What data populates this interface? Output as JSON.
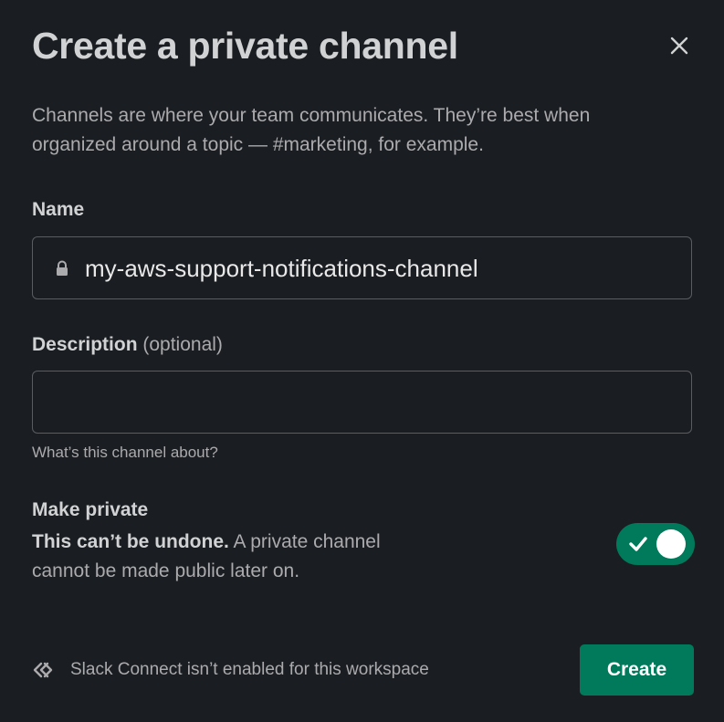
{
  "modal": {
    "title": "Create a private channel",
    "close_icon": "close-icon",
    "intro": "Channels are where your team communicates. They’re best when organized around a topic — #marketing, for example."
  },
  "name_field": {
    "label": "Name",
    "icon": "lock-icon",
    "value": "my-aws-support-notifications-channel"
  },
  "description_field": {
    "label": "Description",
    "optional": "(optional)",
    "value": "",
    "hint": "What’s this channel about?"
  },
  "private_setting": {
    "title": "Make private",
    "warning": "This can’t be undone.",
    "detail": "A private channel cannot be made public later on.",
    "enabled": true
  },
  "footer": {
    "slack_connect_icon": "slack-connect-icon",
    "note": "Slack Connect isn’t enabled for this workspace",
    "create_label": "Create"
  },
  "colors": {
    "background": "#1a1d21",
    "accent": "#007a5a",
    "text_primary": "#d1d2d3",
    "text_secondary": "#ababad",
    "border": "#5b5c5f"
  }
}
